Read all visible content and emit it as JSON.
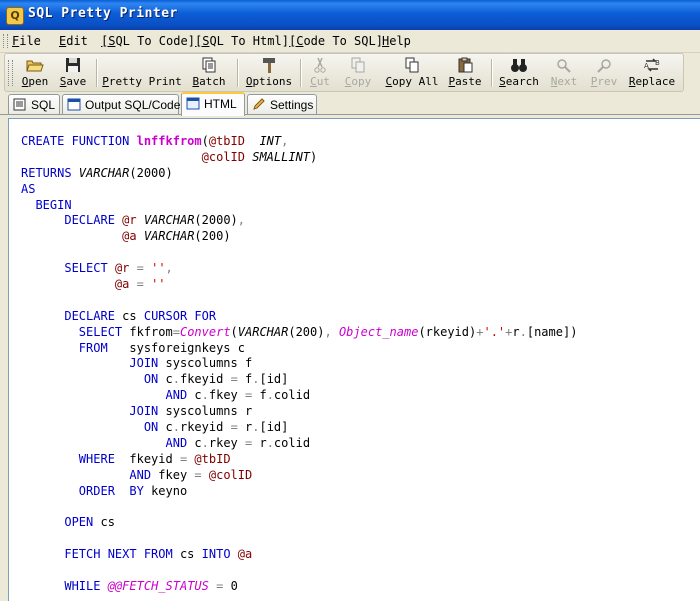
{
  "window": {
    "title": "SQL Pretty Printer",
    "icon": "app-sql-icon"
  },
  "menu": [
    {
      "label": "File"
    },
    {
      "label": "Edit"
    },
    {
      "label": "[SQL To Code]"
    },
    {
      "label": "[SQL To Html]"
    },
    {
      "label": "[Code To SQL]"
    },
    {
      "label": "Help"
    }
  ],
  "toolbar": {
    "open": "Open",
    "save": "Save",
    "pretty_print": "Pretty Print",
    "batch": "Batch",
    "options": "Options",
    "cut": "Cut",
    "copy": "Copy",
    "copy_all": "Copy All",
    "paste": "Paste",
    "search": "Search",
    "next": "Next",
    "prev": "Prev",
    "replace": "Replace"
  },
  "tabs": [
    {
      "label": "SQL"
    },
    {
      "label": "Output SQL/Code"
    },
    {
      "label": "HTML",
      "active": true
    },
    {
      "label": "Settings"
    }
  ],
  "colors": {
    "keyword": "#0000CC",
    "function": "#CC00CC",
    "variable": "#800000",
    "string": "#CC0000",
    "operator": "#808080",
    "titlebar": "#0A4FC4"
  },
  "code": {
    "l1": [
      [
        "k",
        "CREATE FUNCTION "
      ],
      [
        "fb",
        "lnffkfrom"
      ],
      [
        "c",
        "("
      ],
      [
        "v",
        "@tbID"
      ],
      [
        "c",
        "  "
      ],
      [
        "t",
        "INT"
      ],
      [
        "o",
        ","
      ]
    ],
    "l2": [
      [
        "c",
        "                         "
      ],
      [
        "v",
        "@colID"
      ],
      [
        "c",
        " "
      ],
      [
        "t",
        "SMALLINT"
      ],
      [
        "c",
        ")"
      ]
    ],
    "l3": [
      [
        "k",
        "RETURNS "
      ],
      [
        "t",
        "VARCHAR"
      ],
      [
        "c",
        "(2000)"
      ]
    ],
    "l4": [
      [
        "k",
        "AS"
      ]
    ],
    "l5": [
      [
        "c",
        "  "
      ],
      [
        "k",
        "BEGIN"
      ]
    ],
    "l6": [
      [
        "c",
        "      "
      ],
      [
        "k",
        "DECLARE "
      ],
      [
        "v",
        "@r"
      ],
      [
        "c",
        " "
      ],
      [
        "t",
        "VARCHAR"
      ],
      [
        "c",
        "(2000)"
      ],
      [
        "o",
        ","
      ]
    ],
    "l7": [
      [
        "c",
        "              "
      ],
      [
        "v",
        "@a"
      ],
      [
        "c",
        " "
      ],
      [
        "t",
        "VARCHAR"
      ],
      [
        "c",
        "(200)"
      ]
    ],
    "l8": [],
    "l9": [
      [
        "c",
        "      "
      ],
      [
        "k",
        "SELECT "
      ],
      [
        "v",
        "@r"
      ],
      [
        "c",
        " "
      ],
      [
        "o",
        "="
      ],
      [
        "c",
        " "
      ],
      [
        "s",
        "''"
      ],
      [
        "o",
        ","
      ]
    ],
    "l10": [
      [
        "c",
        "             "
      ],
      [
        "v",
        "@a"
      ],
      [
        "c",
        " "
      ],
      [
        "o",
        "="
      ],
      [
        "c",
        " "
      ],
      [
        "s",
        "''"
      ]
    ],
    "l11": [],
    "l12": [
      [
        "c",
        "      "
      ],
      [
        "k",
        "DECLARE "
      ],
      [
        "c",
        "cs "
      ],
      [
        "k",
        "CURSOR FOR"
      ]
    ],
    "l13": [
      [
        "c",
        "        "
      ],
      [
        "k",
        "SELECT "
      ],
      [
        "c",
        "fkfrom"
      ],
      [
        "o",
        "="
      ],
      [
        "f",
        "Convert"
      ],
      [
        "c",
        "("
      ],
      [
        "t",
        "VARCHAR"
      ],
      [
        "c",
        "(200)"
      ],
      [
        "o",
        ","
      ],
      [
        "c",
        " "
      ],
      [
        "f",
        "Object_name"
      ],
      [
        "c",
        "(rkeyid)"
      ],
      [
        "o",
        "+"
      ],
      [
        "s",
        "'.'"
      ],
      [
        "o",
        "+"
      ],
      [
        "c",
        "r"
      ],
      [
        "o",
        "."
      ],
      [
        "c",
        "[name])"
      ]
    ],
    "l14": [
      [
        "c",
        "        "
      ],
      [
        "k",
        "FROM"
      ],
      [
        "c",
        "   sysforeignkeys c"
      ]
    ],
    "l15": [
      [
        "c",
        "               "
      ],
      [
        "k",
        "JOIN "
      ],
      [
        "c",
        "syscolumns f"
      ]
    ],
    "l16": [
      [
        "c",
        "                 "
      ],
      [
        "k",
        "ON "
      ],
      [
        "c",
        "c"
      ],
      [
        "o",
        "."
      ],
      [
        "c",
        "fkeyid "
      ],
      [
        "o",
        "="
      ],
      [
        "c",
        " f"
      ],
      [
        "o",
        "."
      ],
      [
        "c",
        "[id]"
      ]
    ],
    "l17": [
      [
        "c",
        "                    "
      ],
      [
        "k",
        "AND "
      ],
      [
        "c",
        "c"
      ],
      [
        "o",
        "."
      ],
      [
        "c",
        "fkey "
      ],
      [
        "o",
        "="
      ],
      [
        "c",
        " f"
      ],
      [
        "o",
        "."
      ],
      [
        "c",
        "colid"
      ]
    ],
    "l18": [
      [
        "c",
        "               "
      ],
      [
        "k",
        "JOIN "
      ],
      [
        "c",
        "syscolumns r"
      ]
    ],
    "l19": [
      [
        "c",
        "                 "
      ],
      [
        "k",
        "ON "
      ],
      [
        "c",
        "c"
      ],
      [
        "o",
        "."
      ],
      [
        "c",
        "rkeyid "
      ],
      [
        "o",
        "="
      ],
      [
        "c",
        " r"
      ],
      [
        "o",
        "."
      ],
      [
        "c",
        "[id]"
      ]
    ],
    "l20": [
      [
        "c",
        "                    "
      ],
      [
        "k",
        "AND "
      ],
      [
        "c",
        "c"
      ],
      [
        "o",
        "."
      ],
      [
        "c",
        "rkey "
      ],
      [
        "o",
        "="
      ],
      [
        "c",
        " r"
      ],
      [
        "o",
        "."
      ],
      [
        "c",
        "colid"
      ]
    ],
    "l21": [
      [
        "c",
        "        "
      ],
      [
        "k",
        "WHERE"
      ],
      [
        "c",
        "  fkeyid "
      ],
      [
        "o",
        "="
      ],
      [
        "c",
        " "
      ],
      [
        "v",
        "@tbID"
      ]
    ],
    "l22": [
      [
        "c",
        "               "
      ],
      [
        "k",
        "AND "
      ],
      [
        "c",
        "fkey "
      ],
      [
        "o",
        "="
      ],
      [
        "c",
        " "
      ],
      [
        "v",
        "@colID"
      ]
    ],
    "l23": [
      [
        "c",
        "        "
      ],
      [
        "k",
        "ORDER"
      ],
      [
        "c",
        "  "
      ],
      [
        "k",
        "BY "
      ],
      [
        "c",
        "keyno"
      ]
    ],
    "l24": [],
    "l25": [
      [
        "c",
        "      "
      ],
      [
        "k",
        "OPEN "
      ],
      [
        "c",
        "cs"
      ]
    ],
    "l26": [],
    "l27": [
      [
        "c",
        "      "
      ],
      [
        "k",
        "FETCH NEXT FROM "
      ],
      [
        "c",
        "cs "
      ],
      [
        "k",
        "INTO "
      ],
      [
        "v",
        "@a"
      ]
    ],
    "l28": [],
    "l29": [
      [
        "c",
        "      "
      ],
      [
        "k",
        "WHILE "
      ],
      [
        "f",
        "@@FETCH_STATUS"
      ],
      [
        "c",
        " "
      ],
      [
        "o",
        "="
      ],
      [
        "c",
        " 0"
      ]
    ]
  }
}
